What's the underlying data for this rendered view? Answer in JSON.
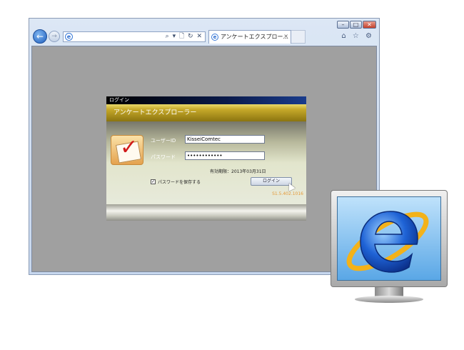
{
  "browser": {
    "tab_title": "アンケートエクスプロー...",
    "tab_close": "×",
    "address_tools": "⌕ ▾ 🗋 ↻ ✕",
    "window_controls": [
      "–",
      "□",
      "✕"
    ],
    "right_icons": "⌂ ☆ ⚙"
  },
  "login": {
    "window_title": "ログイン",
    "app_title": "アンケートエクスプローラー",
    "user_id_label": "ユーザーID",
    "user_id_value": "KisseiComtec",
    "password_label": "パスワード",
    "password_value": "••••••••••••",
    "expiry_text": "有効期限：2013年03月31日",
    "save_password_label": "パスワードを保存する",
    "save_password_checked": true,
    "login_button": "ログイン",
    "version": "S1.5.402.1016"
  },
  "colors": {
    "accent": "#c6a92a",
    "browser_frame": "#c7d7ee",
    "content_bg": "#a0a0a0",
    "version_text": "#e59a3a"
  }
}
